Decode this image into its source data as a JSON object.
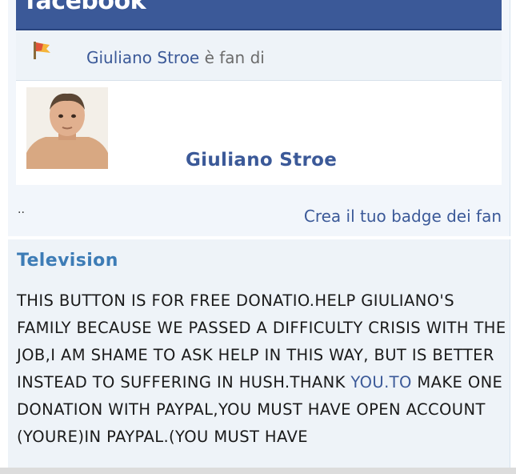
{
  "brand": {
    "logo_text": "facebook"
  },
  "fan_row": {
    "icon": "flag-icon",
    "name": "Giuliano Stroe",
    "suffix": "è fan di"
  },
  "profile": {
    "name": "Giuliano Stroe",
    "avatar": "child-photo"
  },
  "footer": {
    "dots": "..",
    "create_link": "Crea il tuo badge dei fan"
  },
  "info": {
    "title": "Television",
    "text_part1": "THIS BUTTON IS FOR FREE DONATIO.HELP GIULIANO'S FAMILY BECAUSE WE PASSED A DIFFICULTY CRISIS WITH THE JOB,I AM SHAME TO ASK HELP IN THIS WAY, BUT IS BETTER INSTEAD TO SUFFERING IN HUSH.THANK ",
    "text_link": "YOU.TO",
    "text_part2": " MAKE ONE DONATION WITH PAYPAL,YOU MUST HAVE OPEN ACCOUNT (YOURE)IN PAYPAL.(YOU MUST HAVE"
  },
  "colors": {
    "brand_blue": "#3b5998",
    "title_blue": "#3d7cb6",
    "panel_bg": "#eef3f8"
  }
}
